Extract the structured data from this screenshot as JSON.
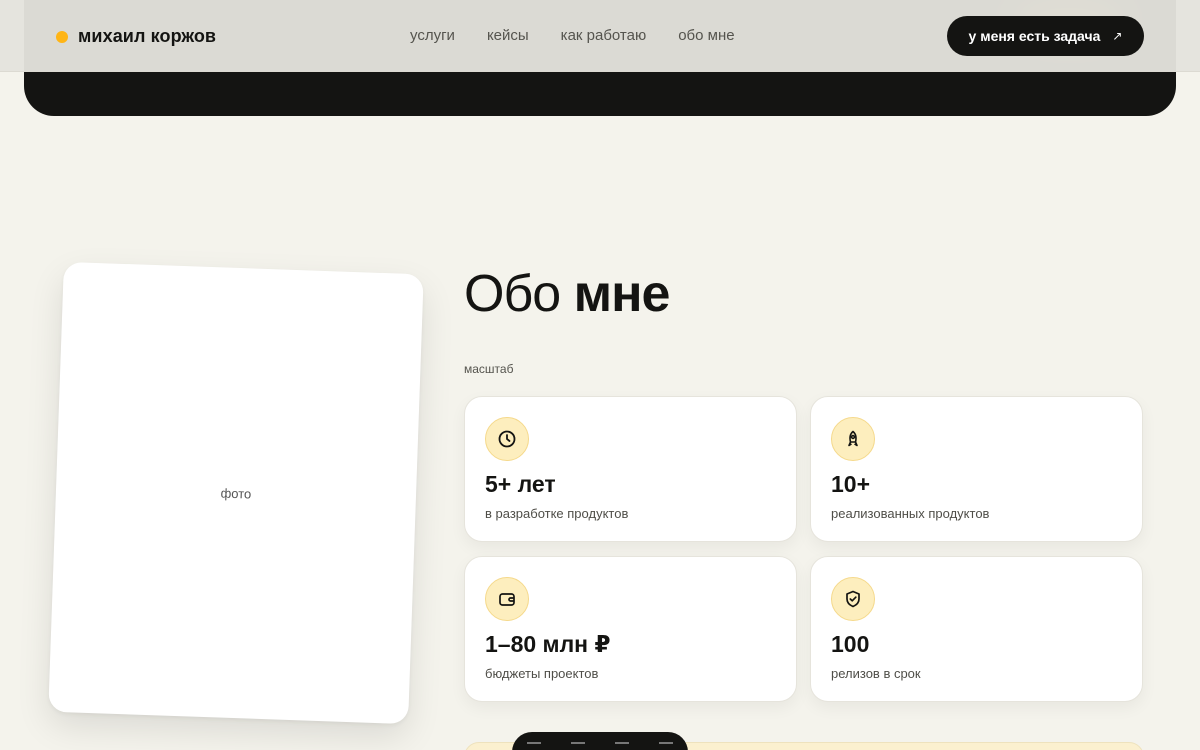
{
  "header": {
    "brand_name": "михаил коржов",
    "nav": [
      "услуги",
      "кейсы",
      "как работаю",
      "обо мне"
    ],
    "cta_label": "у меня есть задача",
    "cta_icon": "arrow-up-right-icon"
  },
  "about": {
    "title_light": "Обо",
    "title_bold": "мне",
    "photo_placeholder": "фото",
    "section_label": "масштаб",
    "stats": [
      {
        "icon": "clock-icon",
        "value": "5+ лет",
        "label": "в разработке продуктов"
      },
      {
        "icon": "rocket-icon",
        "value": "10+",
        "label": "реализованных продуктов"
      },
      {
        "icon": "wallet-icon",
        "value": "1–80 млн ₽",
        "label": "бюджеты проектов"
      },
      {
        "icon": "shield-check-icon",
        "value": "100",
        "label": "релизов в срок"
      }
    ]
  },
  "colors": {
    "accent": "#ffb516",
    "background": "#f4f3ec",
    "dark": "#141412",
    "icon_bg": "#fdeebe"
  }
}
